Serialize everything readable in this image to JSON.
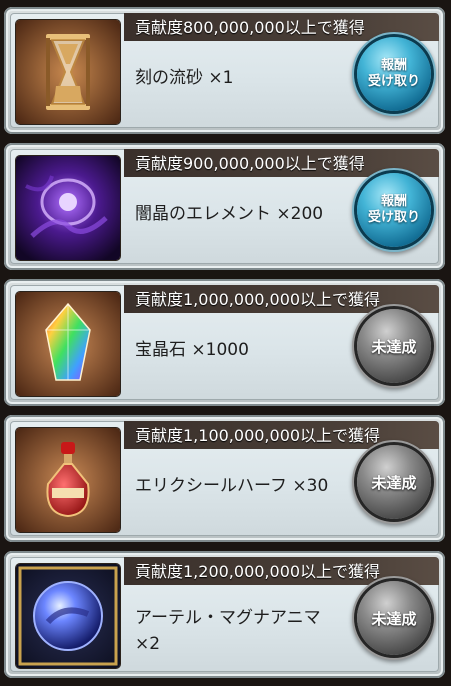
{
  "rewards": [
    {
      "condition": "貢献度800,000,000以上で獲得",
      "item_line1": "刻の流砂 ×1",
      "item_line2": "",
      "icon": "hourglass-icon",
      "button": {
        "state": "claimable",
        "line1": "報酬",
        "line2": "受け取り"
      }
    },
    {
      "condition": "貢献度900,000,000以上で獲得",
      "item_line1": "闇晶のエレメント ×200",
      "item_line2": "",
      "icon": "dark-element-icon",
      "button": {
        "state": "claimable",
        "line1": "報酬",
        "line2": "受け取り"
      }
    },
    {
      "condition": "貢献度1,000,000,000以上で獲得",
      "item_line1": "宝晶石 ×1000",
      "item_line2": "",
      "icon": "crystal-icon",
      "button": {
        "state": "locked",
        "line1": "未達成",
        "line2": ""
      }
    },
    {
      "condition": "貢献度1,100,000,000以上で獲得",
      "item_line1": "エリクシールハーフ ×30",
      "item_line2": "",
      "icon": "elixir-icon",
      "button": {
        "state": "locked",
        "line1": "未達成",
        "line2": ""
      }
    },
    {
      "condition": "貢献度1,200,000,000以上で獲得",
      "item_line1": "アーテル・マグナアニマ",
      "item_line2": "×2",
      "icon": "magna-anima-orb-icon",
      "button": {
        "state": "locked",
        "line1": "未達成",
        "line2": ""
      }
    }
  ],
  "colors": {
    "claim_button": "#2a9fc7",
    "locked_button": "#6a6a6a",
    "header_bar": "#3a302b"
  }
}
